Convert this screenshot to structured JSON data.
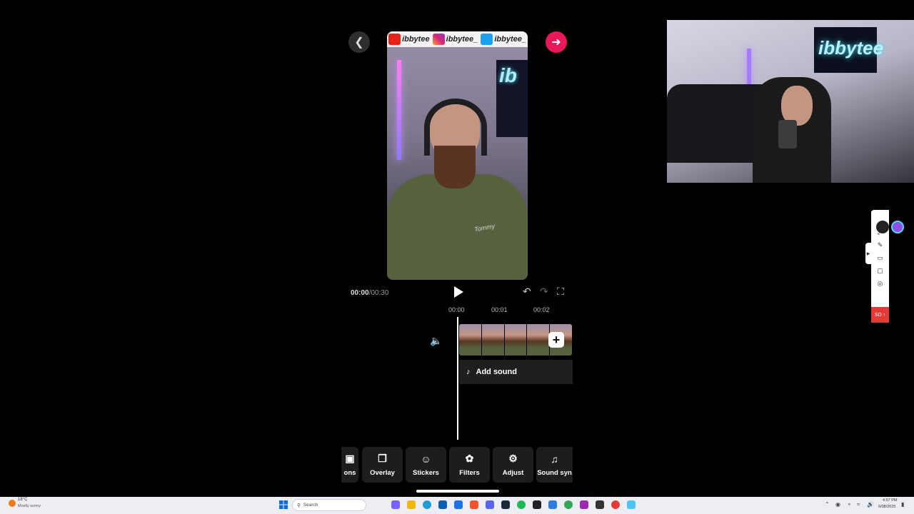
{
  "editor": {
    "time_current": "00:00",
    "time_total": "/00:30",
    "ticks": [
      "00:00",
      "00:01",
      "00:02"
    ],
    "add_sound_label": "Add sound",
    "add_clip_label": "+",
    "social_handles": [
      "ibbytee",
      "ibbytee_",
      "ibbytee_"
    ],
    "preview_sign_text": "ib",
    "hoodie_text": "Tommy"
  },
  "toolbar": {
    "items": [
      {
        "label": "ons",
        "icon": "captions-icon"
      },
      {
        "label": "Overlay",
        "icon": "overlay-icon"
      },
      {
        "label": "Stickers",
        "icon": "stickers-icon"
      },
      {
        "label": "Filters",
        "icon": "filters-icon"
      },
      {
        "label": "Adjust",
        "icon": "adjust-icon"
      },
      {
        "label": "Sound syn",
        "icon": "sound-sync-icon"
      }
    ]
  },
  "webcam": {
    "sign_text": "ibbytee"
  },
  "side_panel": {
    "record_label": "SD"
  },
  "taskbar": {
    "weather_temp": "18°C",
    "weather_desc": "Mostly sunny",
    "search_placeholder": "Search",
    "time": "4:57 PM",
    "date": "6/08/2025"
  },
  "colors": {
    "accent_pink": "#e8185a",
    "record_red": "#e53935",
    "background": "#000000"
  }
}
